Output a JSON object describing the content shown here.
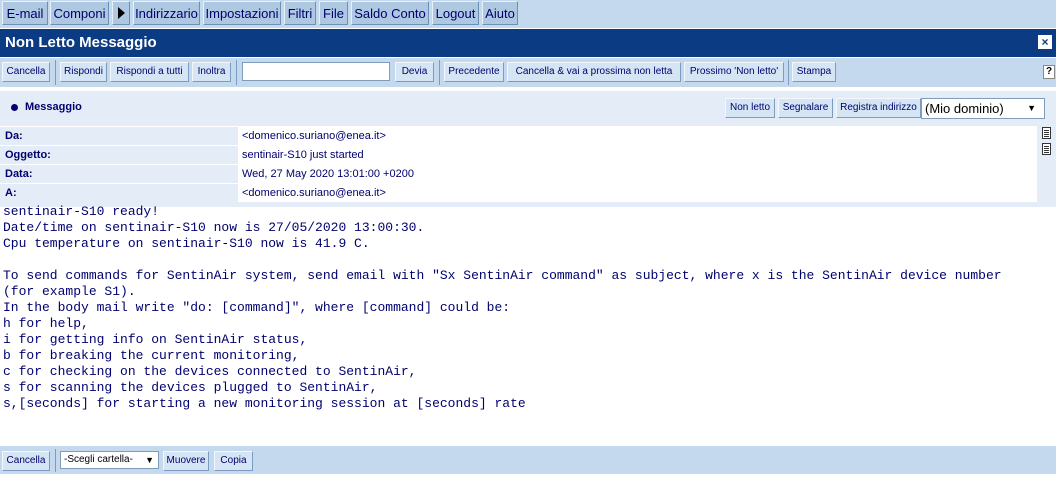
{
  "menu": {
    "email": "E-mail",
    "componi": "Componi",
    "indirizzario": "Indirizzario",
    "impostazioni": "Impostazioni",
    "filtri": "Filtri",
    "file": "File",
    "saldo_conto": "Saldo Conto",
    "logout": "Logout",
    "aiuto": "Aiuto"
  },
  "window": {
    "title": "Non Letto Messaggio",
    "close": "×"
  },
  "toolbar": {
    "cancella": "Cancella",
    "rispondi": "Rispondi",
    "rispondi_tutti": "Rispondi a tutti",
    "inoltra": "Inoltra",
    "forward_value": "",
    "devia": "Devia",
    "precedente": "Precedente",
    "cancella_prossima": "Cancella & vai a prossima non letta",
    "prossimo_non_letto": "Prossimo 'Non letto'",
    "stampa": "Stampa",
    "help": "?"
  },
  "message": {
    "label": "Messaggio",
    "non_letto": "Non letto",
    "segnalare": "Segnalare",
    "registra": "Registra indirizzo",
    "domain_selected": "(Mio dominio)",
    "headers": [
      {
        "key": "Da:",
        "value": "<domenico.suriano@enea.it>"
      },
      {
        "key": "Oggetto:",
        "value": "sentinair-S10 just started"
      },
      {
        "key": "Data:",
        "value": "Wed, 27 May 2020 13:01:00 +0200"
      },
      {
        "key": "A:",
        "value": "<domenico.suriano@enea.it>"
      }
    ],
    "body": "sentinair-S10 ready!\nDate/time on sentinair-S10 now is 27/05/2020 13:00:30.\nCpu temperature on sentinair-S10 now is 41.9 C.\n\nTo send commands for SentinAir system, send email with \"Sx SentinAir command\" as subject, where x is the SentinAir device number\n(for example S1).\nIn the body mail write \"do: [command]\", where [command] could be:\nh for help,\ni for getting info on SentinAir status,\nb for breaking the current monitoring,\nc for checking on the devices connected to SentinAir,\ns for scanning the devices plugged to SentinAir,\ns,[seconds] for starting a new monitoring session at [seconds] rate"
  },
  "bottom": {
    "cancella": "Cancella",
    "folder_selected": "-Scegli cartella-",
    "muovere": "Muovere",
    "copia": "Copia"
  },
  "icons": {
    "arrow": "play-arrow-icon",
    "close": "close-icon",
    "dropdown": "chevron-down-icon",
    "bullet": "bullet-icon",
    "side": "document-icon"
  },
  "colors": {
    "menu_bg": "#c4d9ee",
    "title_bg": "#0b3b82",
    "text": "#00006e"
  }
}
